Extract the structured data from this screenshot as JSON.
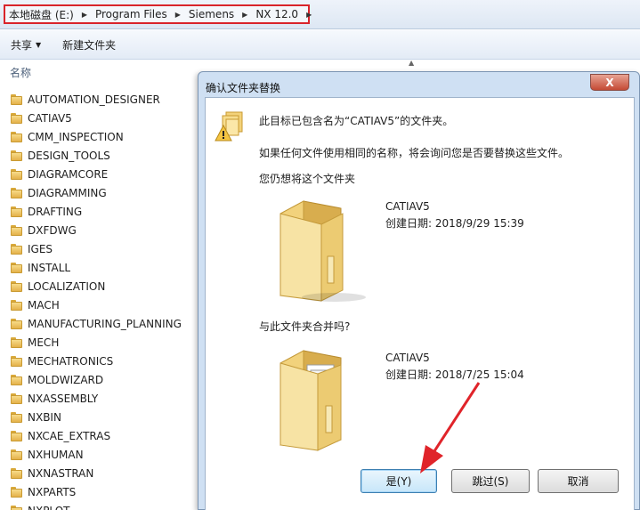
{
  "address_bar": {
    "crumbs": [
      "本地磁盘 (E:)",
      "Program Files",
      "Siemens",
      "NX 12.0"
    ]
  },
  "toolbar": {
    "share_label": "共享",
    "new_folder_label": "新建文件夹"
  },
  "file_list": {
    "column_header": "名称",
    "items": [
      "AUTOMATION_DESIGNER",
      "CATIAV5",
      "CMM_INSPECTION",
      "DESIGN_TOOLS",
      "DIAGRAMCORE",
      "DIAGRAMMING",
      "DRAFTING",
      "DXFDWG",
      "IGES",
      "INSTALL",
      "LOCALIZATION",
      "MACH",
      "MANUFACTURING_PLANNING",
      "MECH",
      "MECHATRONICS",
      "MOLDWIZARD",
      "NXASSEMBLY",
      "NXBIN",
      "NXCAE_EXTRAS",
      "NXHUMAN",
      "NXNASTRAN",
      "NXPARTS",
      "NXPLOT"
    ]
  },
  "dialog": {
    "title": "确认文件夹替换",
    "close_symbol": "X",
    "message_1": "此目标已包含名为“CATIAV5”的文件夹。",
    "message_2": "如果任何文件使用相同的名称，将会询问您是否要替换这些文件。",
    "question_1": "您仍想将这个文件夹",
    "question_2": "与此文件夹合并吗?",
    "existing": {
      "name": "CATIAV5",
      "created": "创建日期: 2018/9/29 15:39"
    },
    "incoming": {
      "name": "CATIAV5",
      "created": "创建日期: 2018/7/25 15:04"
    },
    "buttons": {
      "yes": "是(Y)",
      "skip": "跳过(S)",
      "cancel": "取消"
    }
  },
  "colors": {
    "highlight_border": "#d9242a",
    "arrow": "#e0242a",
    "default_button_border": "#3c7fb1"
  },
  "icons": {
    "breadcrumb_separator": "chevron-right-icon",
    "folder": "folder-icon",
    "warning": "warning-folder-icon"
  }
}
